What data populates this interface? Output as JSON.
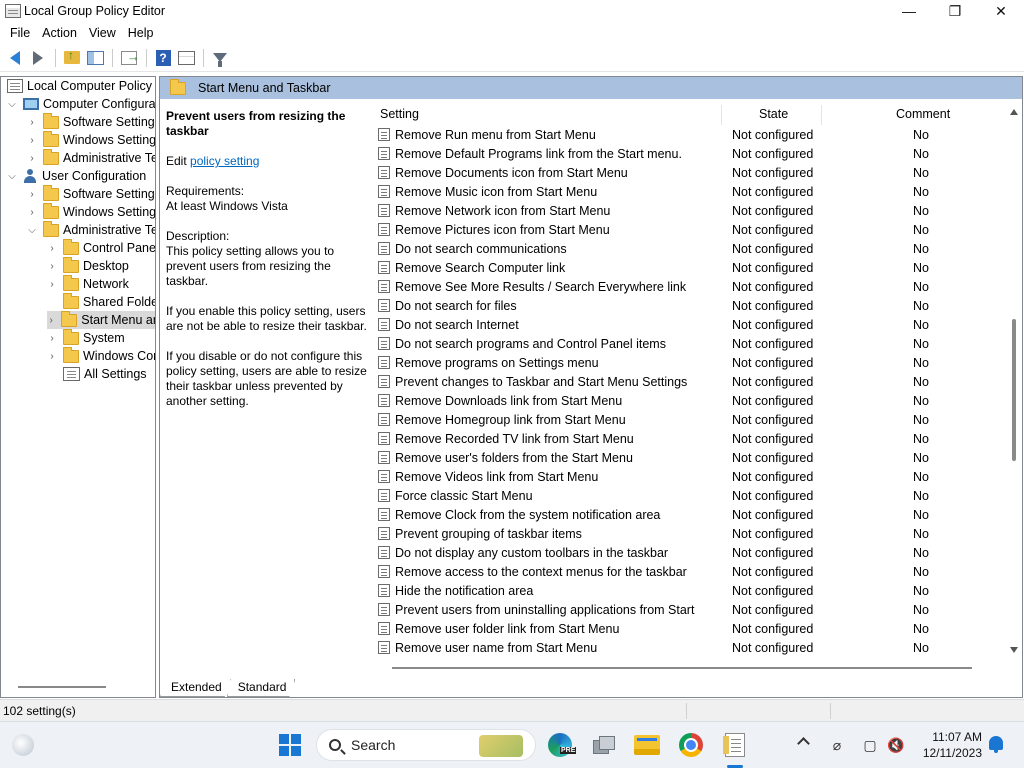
{
  "window": {
    "title": "Local Group Policy Editor",
    "controls": [
      "—",
      "❐",
      "✕"
    ]
  },
  "menu": [
    "File",
    "Action",
    "View",
    "Help"
  ],
  "tree": {
    "root": "Local Computer Policy",
    "computer_config": "Computer Configura",
    "cc_software": "Software Settings",
    "cc_windows": "Windows Setting",
    "cc_admin": "Administrative Te",
    "user_config": "User Configuration",
    "uc_software": "Software Settings",
    "uc_windows": "Windows Setting",
    "uc_admin": "Administrative Te",
    "control_panel": "Control Panel",
    "desktop": "Desktop",
    "network": "Network",
    "shared_folders": "Shared Folder",
    "start_menu": "Start Menu ar",
    "system": "System",
    "windows_components": "Windows Cor",
    "all_settings": "All Settings"
  },
  "pane": {
    "header": "Start Menu and Taskbar",
    "policy_title": "Prevent users from resizing the taskbar",
    "edit_prefix": "Edit",
    "edit_link": "policy setting",
    "requirements_label": "Requirements:",
    "requirements_value": "At least Windows Vista",
    "description_label": "Description:",
    "description_text": "This policy setting allows you to prevent users from resizing the taskbar.",
    "enable_text": "If you enable this policy setting, users are not be able to resize their taskbar.",
    "disable_text": "If you disable or do not configure this policy setting, users are able to resize their taskbar unless prevented by another setting."
  },
  "columns": {
    "setting": "Setting",
    "state": "State",
    "comment": "Comment"
  },
  "rows": [
    {
      "name": "Remove Run menu from Start Menu",
      "state": "Not configured",
      "comment": "No"
    },
    {
      "name": "Remove Default Programs link from the Start menu.",
      "state": "Not configured",
      "comment": "No"
    },
    {
      "name": "Remove Documents icon from Start Menu",
      "state": "Not configured",
      "comment": "No"
    },
    {
      "name": "Remove Music icon from Start Menu",
      "state": "Not configured",
      "comment": "No"
    },
    {
      "name": "Remove Network icon from Start Menu",
      "state": "Not configured",
      "comment": "No"
    },
    {
      "name": "Remove Pictures icon from Start Menu",
      "state": "Not configured",
      "comment": "No"
    },
    {
      "name": "Do not search communications",
      "state": "Not configured",
      "comment": "No"
    },
    {
      "name": "Remove Search Computer link",
      "state": "Not configured",
      "comment": "No"
    },
    {
      "name": "Remove See More Results / Search Everywhere link",
      "state": "Not configured",
      "comment": "No"
    },
    {
      "name": "Do not search for files",
      "state": "Not configured",
      "comment": "No"
    },
    {
      "name": "Do not search Internet",
      "state": "Not configured",
      "comment": "No"
    },
    {
      "name": "Do not search programs and Control Panel items",
      "state": "Not configured",
      "comment": "No"
    },
    {
      "name": "Remove programs on Settings menu",
      "state": "Not configured",
      "comment": "No"
    },
    {
      "name": "Prevent changes to Taskbar and Start Menu Settings",
      "state": "Not configured",
      "comment": "No"
    },
    {
      "name": "Remove Downloads link from Start Menu",
      "state": "Not configured",
      "comment": "No"
    },
    {
      "name": "Remove Homegroup link from Start Menu",
      "state": "Not configured",
      "comment": "No"
    },
    {
      "name": "Remove Recorded TV link from Start Menu",
      "state": "Not configured",
      "comment": "No"
    },
    {
      "name": "Remove user's folders from the Start Menu",
      "state": "Not configured",
      "comment": "No"
    },
    {
      "name": "Remove Videos link from Start Menu",
      "state": "Not configured",
      "comment": "No"
    },
    {
      "name": "Force classic Start Menu",
      "state": "Not configured",
      "comment": "No"
    },
    {
      "name": "Remove Clock from the system notification area",
      "state": "Not configured",
      "comment": "No"
    },
    {
      "name": "Prevent grouping of taskbar items",
      "state": "Not configured",
      "comment": "No"
    },
    {
      "name": "Do not display any custom toolbars in the taskbar",
      "state": "Not configured",
      "comment": "No"
    },
    {
      "name": "Remove access to the context menus for the taskbar",
      "state": "Not configured",
      "comment": "No"
    },
    {
      "name": "Hide the notification area",
      "state": "Not configured",
      "comment": "No"
    },
    {
      "name": "Prevent users from uninstalling applications from Start",
      "state": "Not configured",
      "comment": "No"
    },
    {
      "name": "Remove user folder link from Start Menu",
      "state": "Not configured",
      "comment": "No"
    },
    {
      "name": "Remove user name from Start Menu",
      "state": "Not configured",
      "comment": "No"
    }
  ],
  "tabs": [
    "Extended",
    "Standard"
  ],
  "status": "102 setting(s)",
  "taskbar": {
    "search_placeholder": "Search",
    "edge_badge": "PRE",
    "time": "11:07 AM",
    "date": "12/11/2023"
  },
  "colors": {
    "pane_header_bg": "#a9c1de",
    "link": "#0067c0",
    "accent": "#1976d2"
  }
}
